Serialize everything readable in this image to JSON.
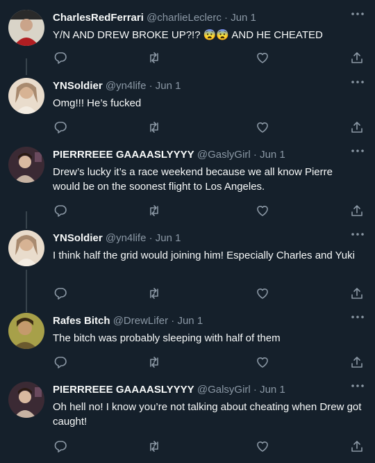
{
  "tweets": [
    {
      "name": "CharlesRedFerrari",
      "handle": "@charlieLeclerc",
      "date": "Jun 1",
      "text": "Y/N AND DREW BROKE UP?!? 😨😨 AND HE CHEATED",
      "avatar_colors": [
        "#d9d4c8",
        "#b01e22"
      ]
    },
    {
      "name": "YNSoldier",
      "handle": "@yn4life",
      "date": "Jun 1",
      "text": "Omg!!!  He’s fucked",
      "avatar_colors": [
        "#a88a6f",
        "#e9dccc"
      ]
    },
    {
      "name": "PIERRREEE GAAAASLYYYY",
      "handle": "@GaslyGirl",
      "date": "Jun 1",
      "text": "Drew’s lucky it’s a race weekend because we all know Pierre would be on the soonest flight to Los Angeles.",
      "avatar_colors": [
        "#3b2a34",
        "#c7b3a3"
      ]
    },
    {
      "name": "YNSoldier",
      "handle": "@yn4life",
      "date": "Jun 1",
      "text": "I think half the grid would joining him! Especially Charles and Yuki",
      "avatar_colors": [
        "#a88a6f",
        "#e9dccc"
      ]
    },
    {
      "name": "Rafes Bitch",
      "handle": "@DrewLifer",
      "date": "Jun 1",
      "text": "The bitch was probably sleeping with half of them",
      "avatar_colors": [
        "#a7a049",
        "#6b5a2e"
      ]
    },
    {
      "name": "PIERRREEE GAAAASLYYYY",
      "handle": "@GalsyGirl",
      "date": "Jun 1",
      "text": "Oh hell no! I know you’re not talking about cheating when Drew got caught!",
      "avatar_colors": [
        "#3b2a34",
        "#c7b3a3"
      ]
    }
  ],
  "separator": "·",
  "icons": {
    "more": "more-horizontal-icon",
    "reply": "reply-icon",
    "retweet": "retweet-icon",
    "like": "heart-icon",
    "share": "share-icon"
  },
  "colors": {
    "background": "#15202b",
    "text": "#f7f9f9",
    "muted": "#8b98a5",
    "thread_line": "#38444d"
  }
}
